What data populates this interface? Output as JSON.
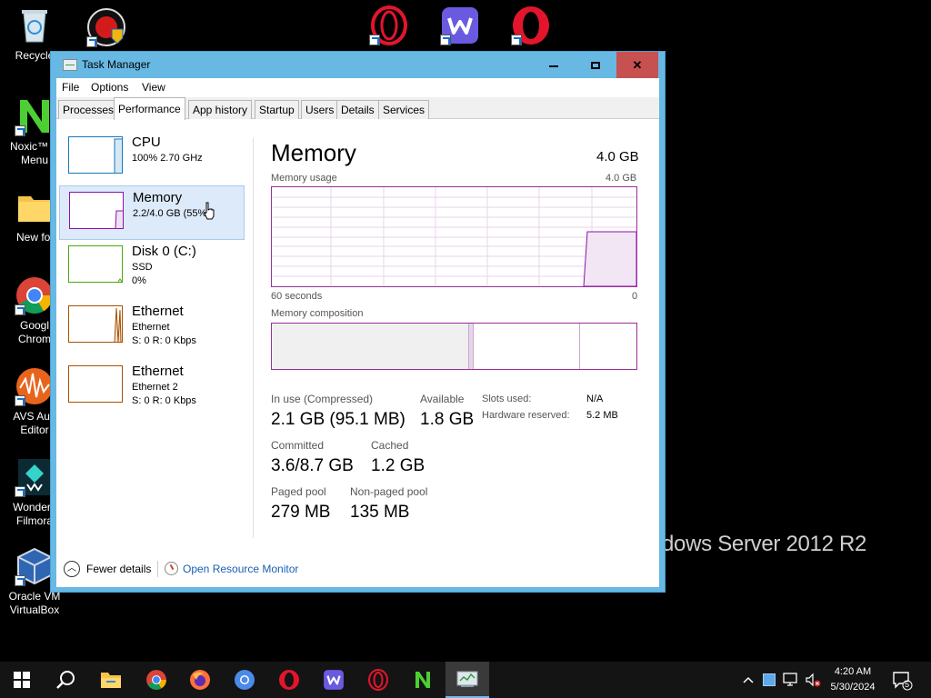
{
  "desktop": {
    "icons": [
      {
        "label": "Recycle"
      },
      {
        "label": ""
      },
      {
        "label": "Noxic™ N\nMenu"
      },
      {
        "label": "New fol"
      },
      {
        "label": "Googl\nChrom"
      },
      {
        "label": "AVS Aud\nEditor"
      },
      {
        "label": "Wonders\nFilmora"
      },
      {
        "label": "Oracle VM\nVirtualBox"
      }
    ],
    "watermark": "dows Server 2012 R2"
  },
  "window": {
    "title": "Task Manager",
    "menu": [
      "File",
      "Options",
      "View"
    ],
    "tabs": [
      "Processes",
      "Performance",
      "App history",
      "Startup",
      "Users",
      "Details",
      "Services"
    ],
    "active_tab": "Performance"
  },
  "sidebar": {
    "items": [
      {
        "name": "CPU",
        "sub1": "100%  2.70 GHz",
        "sub2": "",
        "sub3": "",
        "color": "#1779ba"
      },
      {
        "name": "Memory",
        "sub1": "2.2/4.0 GB (55%)",
        "sub2": "",
        "sub3": "",
        "color": "#8b12ae",
        "selected": true
      },
      {
        "name": "Disk 0 (C:)",
        "sub1": "SSD",
        "sub2": "0%",
        "sub3": "",
        "color": "#4da60c"
      },
      {
        "name": "Ethernet",
        "sub1": "Ethernet",
        "sub2": "S: 0 R: 0 Kbps",
        "sub3": "",
        "color": "#a74f01"
      },
      {
        "name": "Ethernet",
        "sub1": "Ethernet 2",
        "sub2": "S: 0 R: 0 Kbps",
        "sub3": "",
        "color": "#a74f01"
      }
    ]
  },
  "main": {
    "title": "Memory",
    "total": "4.0 GB",
    "usage_label": "Memory usage",
    "usage_max": "4.0 GB",
    "time_left": "60 seconds",
    "time_right": "0",
    "composition_label": "Memory composition",
    "usage_fraction": 0.55,
    "stats": {
      "in_use_label": "In use (Compressed)",
      "in_use_value": "2.1 GB (95.1 MB)",
      "available_label": "Available",
      "available_value": "1.8 GB",
      "committed_label": "Committed",
      "committed_value": "3.6/8.7 GB",
      "cached_label": "Cached",
      "cached_value": "1.2 GB",
      "paged_label": "Paged pool",
      "paged_value": "279 MB",
      "nonpaged_label": "Non-paged pool",
      "nonpaged_value": "135 MB",
      "slots_label": "Slots used:",
      "slots_value": "N/A",
      "hw_label": "Hardware reserved:",
      "hw_value": "5.2 MB"
    }
  },
  "footer": {
    "fewer_details": "Fewer details",
    "open_resource_monitor": "Open Resource Monitor"
  },
  "taskbar": {
    "time": "4:20 AM",
    "date": "5/30/2024",
    "notification_count": "5"
  },
  "colors": {
    "memory": "#8b12ae",
    "window_border": "#67b8e3",
    "close": "#c75050",
    "selection": "#dceafa"
  }
}
